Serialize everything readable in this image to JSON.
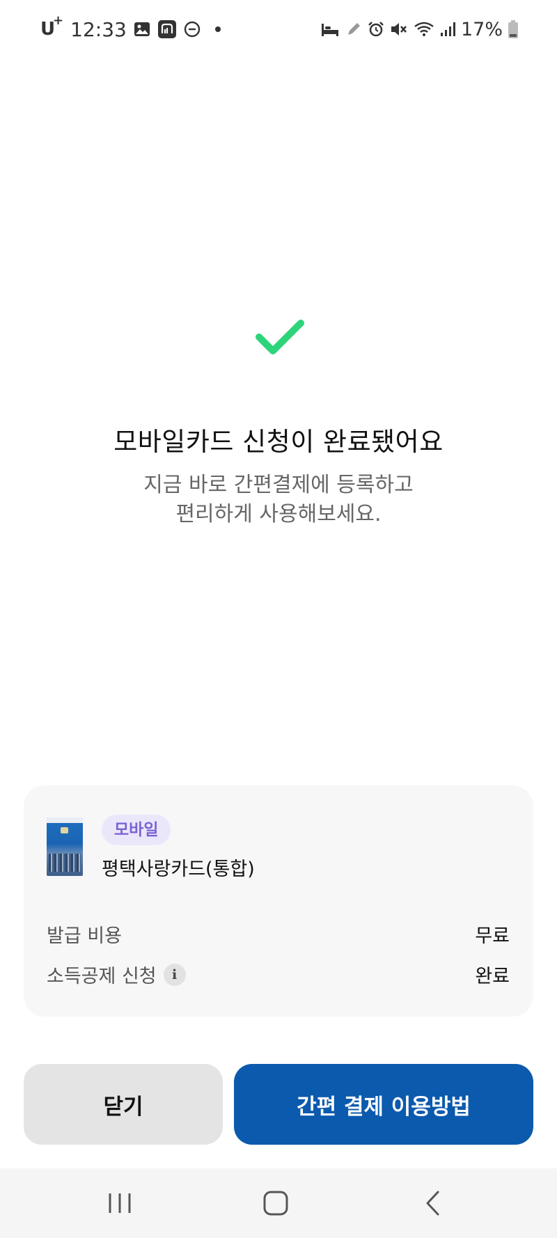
{
  "status_bar": {
    "carrier": "U",
    "carrier_plus": "+",
    "time": "12:33",
    "battery": "17%",
    "left_icons": [
      "gallery-icon",
      "app-badge-icon",
      "dnd-icon",
      "notification-dot-icon"
    ],
    "right_icons": [
      "sleep-mode-icon",
      "pen-icon",
      "alarm-icon",
      "mute-icon",
      "wifi-icon",
      "signal-icon",
      "battery-icon"
    ]
  },
  "success": {
    "icon": "checkmark-icon",
    "icon_color": "#2ed47a",
    "title": "모바일카드 신청이 완료됐어요",
    "subtitle_line1": "지금 바로 간편결제에 등록하고",
    "subtitle_line2": "편리하게 사용해보세요."
  },
  "card": {
    "badge": "모바일",
    "name": "평택사랑카드(통합)",
    "rows": [
      {
        "label": "발급 비용",
        "value": "무료"
      },
      {
        "label": "소득공제 신청",
        "value": "완료",
        "info_icon": "i"
      }
    ]
  },
  "buttons": {
    "close": "닫기",
    "guide": "간편 결제 이용방법",
    "guide_color": "#0b5aad"
  },
  "nav": {
    "icons": [
      "recent-apps-icon",
      "home-icon",
      "back-icon"
    ]
  }
}
